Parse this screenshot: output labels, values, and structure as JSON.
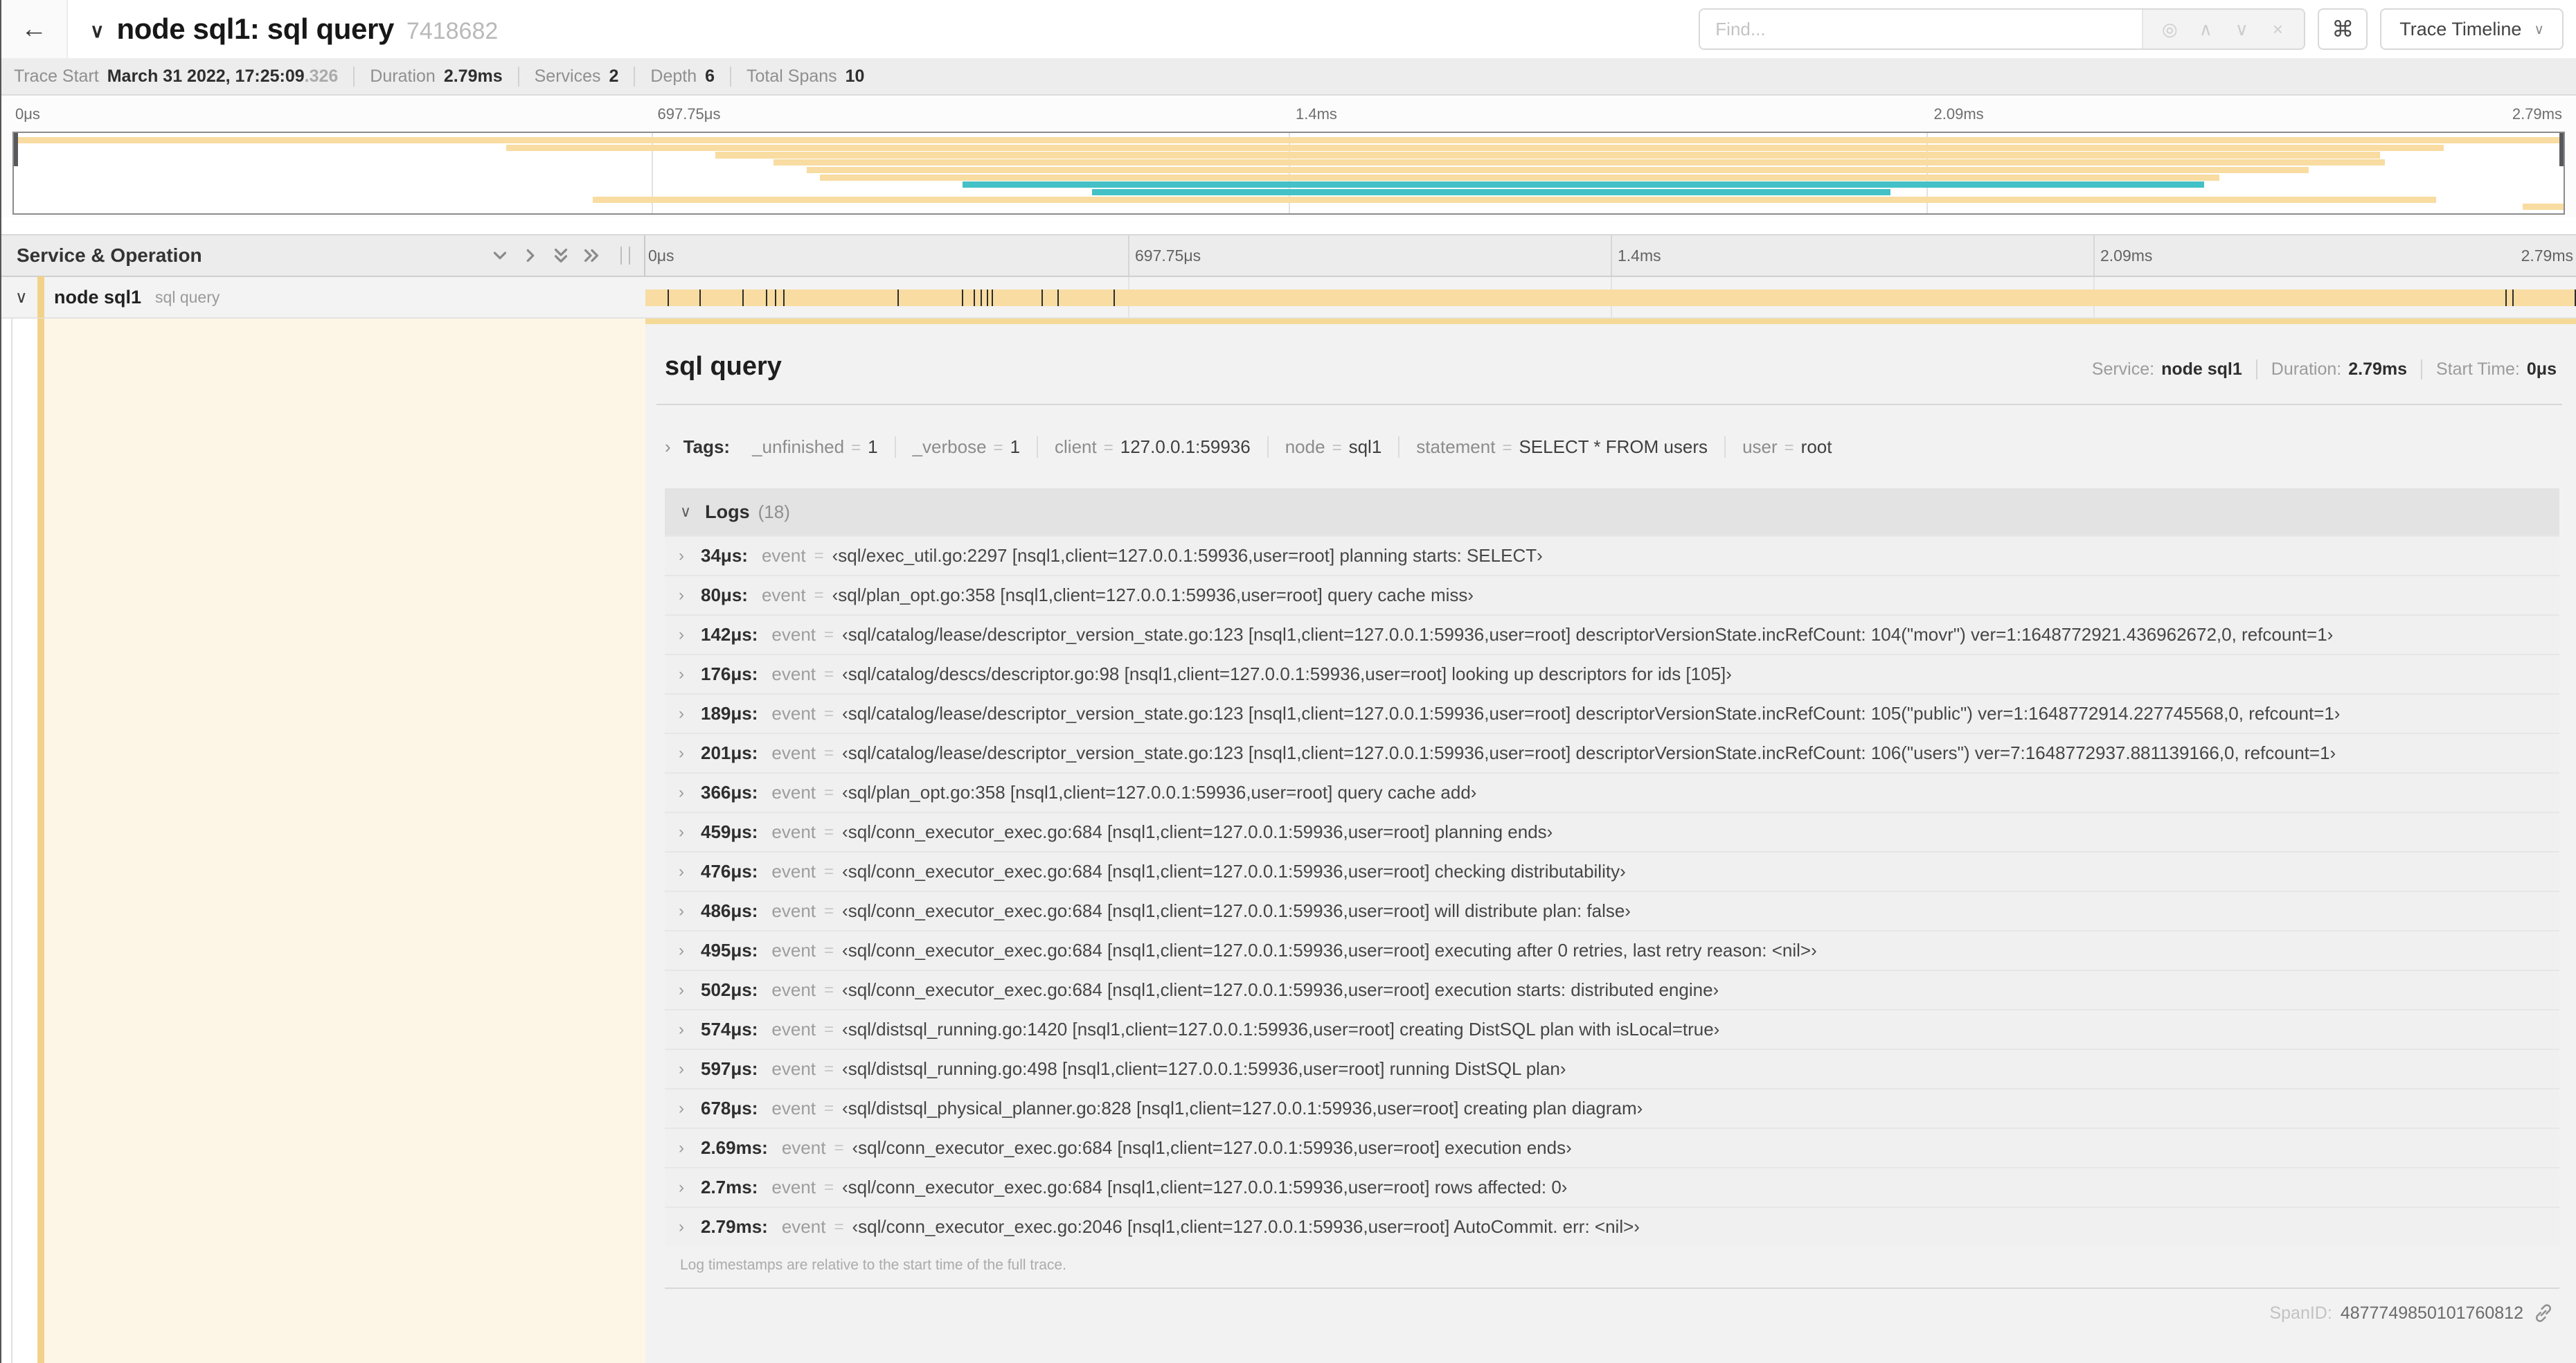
{
  "colors": {
    "tan": "#F8DCA1",
    "teal": "#43C1C6",
    "accent": "#F2D28A",
    "accent_bar": "#F5DA97",
    "cream": "#FDF6E7"
  },
  "icons": {
    "back": "←",
    "chevron_down": "∨",
    "command": "⌘",
    "focus": "◎",
    "prev": "∧",
    "next": "∨",
    "clear": "×",
    "row_chevron": "∨",
    "tags_chevron": "›",
    "logs_chevron": "∨",
    "log_chevron": "›"
  },
  "header": {
    "title": "node sql1: sql query",
    "trace_id": "7418682",
    "find_placeholder": "Find...",
    "view_button": "Trace Timeline"
  },
  "subheader": {
    "stats": [
      {
        "label": "Trace Start",
        "value": "March 31 2022, 17:25:09",
        "extra": ".326"
      },
      {
        "label": "Duration",
        "value": "2.79ms"
      },
      {
        "label": "Services",
        "value": "2"
      },
      {
        "label": "Depth",
        "value": "6"
      },
      {
        "label": "Total Spans",
        "value": "10"
      }
    ]
  },
  "minimap": {
    "ticks": [
      {
        "label": "0μs",
        "pos": 0
      },
      {
        "label": "697.75μs",
        "pos": 25
      },
      {
        "label": "1.4ms",
        "pos": 50
      },
      {
        "label": "2.09ms",
        "pos": 75
      },
      {
        "label": "2.79ms",
        "pos": 100
      }
    ],
    "spans": [
      {
        "row": 0,
        "start": 0.0,
        "end": 1.0,
        "color": "tan"
      },
      {
        "row": 1,
        "start": 0.193,
        "end": 0.953,
        "color": "tan"
      },
      {
        "row": 2,
        "start": 0.275,
        "end": 0.928,
        "color": "tan"
      },
      {
        "row": 3,
        "start": 0.298,
        "end": 0.93,
        "color": "tan"
      },
      {
        "row": 4,
        "start": 0.311,
        "end": 0.9,
        "color": "tan"
      },
      {
        "row": 5,
        "start": 0.316,
        "end": 0.865,
        "color": "tan"
      },
      {
        "row": 6,
        "start": 0.372,
        "end": 0.859,
        "color": "teal"
      },
      {
        "row": 7,
        "start": 0.423,
        "end": 0.736,
        "color": "teal"
      },
      {
        "row": 8,
        "start": 0.227,
        "end": 0.95,
        "color": "tan"
      },
      {
        "row": 9,
        "start": 0.984,
        "end": 1.0,
        "color": "tan"
      }
    ]
  },
  "timeline": {
    "left_header": "Service & Operation",
    "ticks": [
      {
        "label": "0μs",
        "pos": 0
      },
      {
        "label": "697.75μs",
        "pos": 25
      },
      {
        "label": "1.4ms",
        "pos": 50
      },
      {
        "label": "2.09ms",
        "pos": 75
      },
      {
        "label": "2.79ms",
        "pos": 100
      }
    ]
  },
  "span_row": {
    "service": "node sql1",
    "operation": "sql query",
    "duration_us": 2790,
    "tick_times_us": [
      34,
      80,
      142,
      176,
      189,
      201,
      366,
      459,
      476,
      486,
      495,
      502,
      574,
      597,
      678,
      2690,
      2700,
      2790
    ]
  },
  "detail": {
    "title": "sql query",
    "meta": [
      {
        "label": "Service:",
        "value": "node sql1"
      },
      {
        "label": "Duration:",
        "value": "2.79ms"
      },
      {
        "label": "Start Time:",
        "value": "0μs"
      }
    ],
    "tags": {
      "label": "Tags:",
      "items": [
        {
          "key": "_unfinished",
          "value": "1"
        },
        {
          "key": "_verbose",
          "value": "1"
        },
        {
          "key": "client",
          "value": "127.0.0.1:59936"
        },
        {
          "key": "node",
          "value": "sql1"
        },
        {
          "key": "statement",
          "value": "SELECT * FROM users"
        },
        {
          "key": "user",
          "value": "root"
        }
      ]
    },
    "logs": {
      "label": "Logs",
      "count_label": "(18)",
      "event_key": "event",
      "eq": "=",
      "entries": [
        {
          "time": "34μs:",
          "event": "‹sql/exec_util.go:2297 [nsql1,client=127.0.0.1:59936,user=root] planning starts: SELECT›"
        },
        {
          "time": "80μs:",
          "event": "‹sql/plan_opt.go:358 [nsql1,client=127.0.0.1:59936,user=root] query cache miss›"
        },
        {
          "time": "142μs:",
          "event": "‹sql/catalog/lease/descriptor_version_state.go:123 [nsql1,client=127.0.0.1:59936,user=root] descriptorVersionState.incRefCount: 104(\"movr\") ver=1:1648772921.436962672,0, refcount=1›"
        },
        {
          "time": "176μs:",
          "event": "‹sql/catalog/descs/descriptor.go:98 [nsql1,client=127.0.0.1:59936,user=root] looking up descriptors for ids [105]›"
        },
        {
          "time": "189μs:",
          "event": "‹sql/catalog/lease/descriptor_version_state.go:123 [nsql1,client=127.0.0.1:59936,user=root] descriptorVersionState.incRefCount: 105(\"public\") ver=1:1648772914.227745568,0, refcount=1›"
        },
        {
          "time": "201μs:",
          "event": "‹sql/catalog/lease/descriptor_version_state.go:123 [nsql1,client=127.0.0.1:59936,user=root] descriptorVersionState.incRefCount: 106(\"users\") ver=7:1648772937.881139166,0, refcount=1›"
        },
        {
          "time": "366μs:",
          "event": "‹sql/plan_opt.go:358 [nsql1,client=127.0.0.1:59936,user=root] query cache add›"
        },
        {
          "time": "459μs:",
          "event": "‹sql/conn_executor_exec.go:684 [nsql1,client=127.0.0.1:59936,user=root] planning ends›"
        },
        {
          "time": "476μs:",
          "event": "‹sql/conn_executor_exec.go:684 [nsql1,client=127.0.0.1:59936,user=root] checking distributability›"
        },
        {
          "time": "486μs:",
          "event": "‹sql/conn_executor_exec.go:684 [nsql1,client=127.0.0.1:59936,user=root] will distribute plan: false›"
        },
        {
          "time": "495μs:",
          "event": "‹sql/conn_executor_exec.go:684 [nsql1,client=127.0.0.1:59936,user=root] executing after 0 retries, last retry reason: <nil>›"
        },
        {
          "time": "502μs:",
          "event": "‹sql/conn_executor_exec.go:684 [nsql1,client=127.0.0.1:59936,user=root] execution starts: distributed engine›"
        },
        {
          "time": "574μs:",
          "event": "‹sql/distsql_running.go:1420 [nsql1,client=127.0.0.1:59936,user=root] creating DistSQL plan with isLocal=true›"
        },
        {
          "time": "597μs:",
          "event": "‹sql/distsql_running.go:498 [nsql1,client=127.0.0.1:59936,user=root] running DistSQL plan›"
        },
        {
          "time": "678μs:",
          "event": "‹sql/distsql_physical_planner.go:828 [nsql1,client=127.0.0.1:59936,user=root] creating plan diagram›"
        },
        {
          "time": "2.69ms:",
          "event": "‹sql/conn_executor_exec.go:684 [nsql1,client=127.0.0.1:59936,user=root] execution ends›"
        },
        {
          "time": "2.7ms:",
          "event": "‹sql/conn_executor_exec.go:684 [nsql1,client=127.0.0.1:59936,user=root] rows affected: 0›"
        },
        {
          "time": "2.79ms:",
          "event": "‹sql/conn_executor_exec.go:2046 [nsql1,client=127.0.0.1:59936,user=root] AutoCommit. err: <nil>›"
        }
      ],
      "footer": "Log timestamps are relative to the start time of the full trace."
    },
    "span_id_label": "SpanID:",
    "span_id": "4877749850101760812"
  }
}
